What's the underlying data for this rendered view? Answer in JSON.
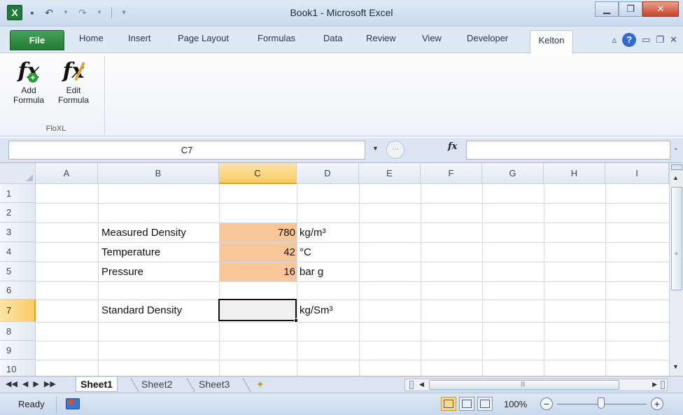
{
  "window": {
    "title": "Book1  -  Microsoft Excel",
    "app_icon": "X",
    "controls": [
      "minimize-icon",
      "restore-icon",
      "close-icon"
    ]
  },
  "ribbon": {
    "file_tab": "File",
    "tabs": [
      "Home",
      "Insert",
      "Page Layout",
      "Formulas",
      "Data",
      "Review",
      "View",
      "Developer",
      "Kelton"
    ],
    "active_tab": "Kelton",
    "group": {
      "label": "FloXL",
      "buttons": [
        {
          "line1": "Add",
          "line2": "Formula",
          "glyph": "fx",
          "icon": "add-formula-icon"
        },
        {
          "line1": "Edit",
          "line2": "Formula",
          "glyph": "fx",
          "icon": "edit-formula-icon"
        }
      ]
    }
  },
  "formula_bar": {
    "name_box": "C7",
    "fx_label": "fx",
    "formula": ""
  },
  "grid": {
    "columns": [
      "A",
      "B",
      "C",
      "D",
      "E",
      "F",
      "G",
      "H",
      "I"
    ],
    "selected_column": "C",
    "rows": [
      "1",
      "2",
      "3",
      "4",
      "5",
      "6",
      "7",
      "8",
      "9",
      "10"
    ],
    "selected_row": "7",
    "active_cell": "C7",
    "highlight_color": "#f9c69a",
    "cells": {
      "B3": "Measured Density",
      "C3": "780",
      "D3": "kg/m³",
      "B4": "Temperature",
      "C4": "42",
      "D4": "°C",
      "B5": "Pressure",
      "C5": "16",
      "D5": "bar g",
      "B7": "Standard Density",
      "C7": "",
      "D7": "kg/Sm³"
    }
  },
  "sheets": {
    "nav": [
      "◀◀",
      "◀",
      "▶",
      "▶▶"
    ],
    "tabs": [
      "Sheet1",
      "Sheet2",
      "Sheet3"
    ],
    "active": "Sheet1"
  },
  "status": {
    "ready": "Ready",
    "zoom": "100%",
    "zoom_minus": "−",
    "zoom_plus": "+"
  }
}
